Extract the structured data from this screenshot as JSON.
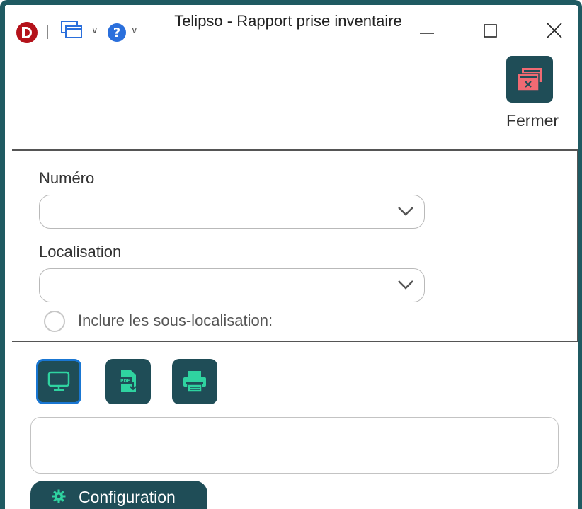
{
  "window": {
    "title": "Telipso - Rapport prise inventaire"
  },
  "toolbar": {
    "close_label": "Fermer"
  },
  "form": {
    "numero": {
      "label": "Numéro",
      "value": ""
    },
    "localisation": {
      "label": "Localisation",
      "value": ""
    },
    "include_sublocations": {
      "label": "Inclure les sous-localisation:",
      "checked": false
    }
  },
  "output": {
    "buttons": [
      {
        "icon": "monitor-icon",
        "selected": true
      },
      {
        "icon": "pdf-download-icon",
        "selected": false
      },
      {
        "icon": "printer-icon",
        "selected": false
      }
    ],
    "message": ""
  },
  "footer": {
    "config_label": "Configuration"
  },
  "colors": {
    "frame": "#1f5a62",
    "button_bg": "#1f4d57",
    "icon_green": "#2fd3a0",
    "close_icon_red": "#f06a73",
    "selected_border": "#1976d2"
  }
}
